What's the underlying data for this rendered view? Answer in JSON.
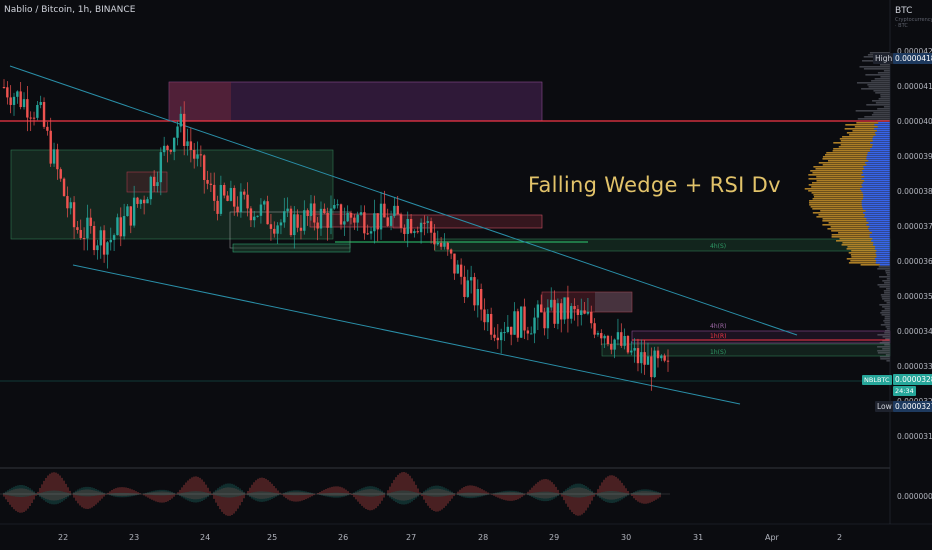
{
  "header": {
    "symbol": "Nablio / Bitcoin, 1h, BINANCE"
  },
  "currency": {
    "code": "BTC",
    "sub": "Cryptocurrency · BTC"
  },
  "annotation": {
    "text": "Falling Wedge + RSI Dv"
  },
  "price_tags": {
    "high_label": "High",
    "high_value": "0.00004188",
    "symbol_tag": "NBLBTC",
    "current_value": "0.00003287",
    "countdown": "24:34",
    "low_label": "Low",
    "low_value": "0.00003278"
  },
  "y_axis": {
    "ticks": [
      "0.00004200",
      "0.00004100",
      "0.00004000",
      "0.00003900",
      "0.00003800",
      "0.00003700",
      "0.00003600",
      "0.00003500",
      "0.00003400",
      "0.00003300",
      "0.00003200",
      "0.00003100"
    ],
    "osc_tick": "0.00000000"
  },
  "x_axis": {
    "ticks": [
      "22",
      "23",
      "24",
      "25",
      "26",
      "27",
      "28",
      "29",
      "30",
      "31",
      "Apr",
      "2"
    ]
  },
  "level_labels": {
    "h4": "4h(S)",
    "r4": "4h(R)",
    "r1": "1h(R)",
    "s1": "1h(S)"
  },
  "colors": {
    "up": "#26a69a",
    "down": "#ef5350",
    "wedge": "#2a8fa8",
    "resistance": "#f23645",
    "title": "#e2c36a",
    "vp_gold": "#c9932a",
    "vp_blue": "#2962ff"
  },
  "chart_data": {
    "type": "candlestick",
    "title": "Falling Wedge + RSI Dv",
    "ylim": [
      3.05e-05,
      4.27e-05
    ],
    "close_series_approx": [
      {
        "x": "Mar 21 00:00",
        "y": 4.1e-05
      },
      {
        "x": "Mar 21 12:00",
        "y": 4.03e-05
      },
      {
        "x": "Mar 22 00:00",
        "y": 3.7e-05
      },
      {
        "x": "Mar 22 12:00",
        "y": 3.66e-05
      },
      {
        "x": "Mar 23 00:00",
        "y": 3.79e-05
      },
      {
        "x": "Mar 23 12:00",
        "y": 4e-05
      },
      {
        "x": "Mar 24 00:00",
        "y": 3.78e-05
      },
      {
        "x": "Mar 24 12:00",
        "y": 3.76e-05
      },
      {
        "x": "Mar 25 00:00",
        "y": 3.71e-05
      },
      {
        "x": "Mar 25 12:00",
        "y": 3.73e-05
      },
      {
        "x": "Mar 26 00:00",
        "y": 3.73e-05
      },
      {
        "x": "Mar 26 12:00",
        "y": 3.72e-05
      },
      {
        "x": "Mar 27 00:00",
        "y": 3.72e-05
      },
      {
        "x": "Mar 27 12:00",
        "y": 3.57e-05
      },
      {
        "x": "Mar 28 00:00",
        "y": 3.42e-05
      },
      {
        "x": "Mar 28 12:00",
        "y": 3.43e-05
      },
      {
        "x": "Mar 29 00:00",
        "y": 3.46e-05
      },
      {
        "x": "Mar 29 12:00",
        "y": 3.42e-05
      },
      {
        "x": "Mar 30 00:00",
        "y": 3.33e-05
      },
      {
        "x": "Mar 30 12:00",
        "y": 3.287e-05
      }
    ],
    "high": 4.188e-05,
    "low": 3.278e-05,
    "last": 3.287e-05,
    "levels": {
      "resistance": 4.01e-05,
      "h4_support": 3.7e-05,
      "r4": 3.43e-05,
      "r1": 3.39e-05,
      "s1": 3.34e-05
    },
    "wedge": {
      "upper": [
        [
          "Mar 21 00:00",
          4.175e-05
        ],
        [
          "Mar 31 12:00",
          3.43e-05
        ]
      ],
      "lower": [
        [
          "Mar 21 00:00",
          3.85e-05
        ],
        [
          "Mar 31 12:00",
          3.18e-05
        ]
      ]
    }
  }
}
